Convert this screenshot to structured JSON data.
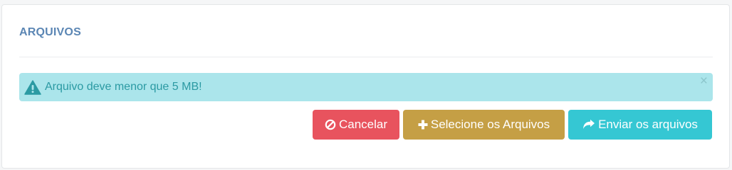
{
  "panel": {
    "title": "ARQUIVOS"
  },
  "alert": {
    "message": "Arquivo deve menor que 5 MB!",
    "icon": "warning-triangle-icon",
    "close_label": "×"
  },
  "buttons": {
    "cancel_label": "Cancelar",
    "cancel_icon": "ban-icon",
    "select_label": "Selecione os Arquivos",
    "select_icon": "plus-icon",
    "send_label": "Enviar os arquivos",
    "send_icon": "share-arrow-icon"
  },
  "colors": {
    "title": "#5b86b4",
    "alert_bg": "#abe5eb",
    "alert_text": "#2b9aa3",
    "cancel": "#e8535e",
    "select": "#c59f45",
    "send": "#35c7d3"
  }
}
